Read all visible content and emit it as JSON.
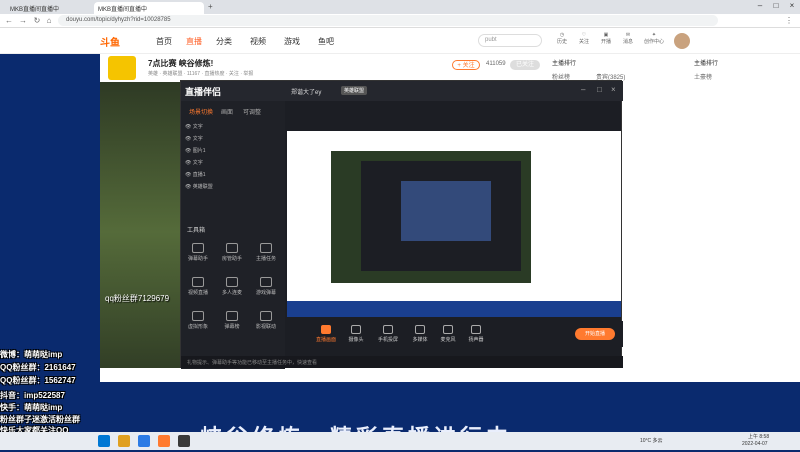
{
  "browser": {
    "tabs": [
      {
        "label": "MKB直播间直播中",
        "active": false
      },
      {
        "label": "MKB直播间直播中",
        "active": true
      }
    ],
    "url": "douyu.com/topic/dyhyzh?rid=10028785"
  },
  "site": {
    "logo": "斗鱼",
    "nav": [
      "首页",
      "直播",
      "分类",
      "视频",
      "游戏",
      "鱼吧"
    ],
    "active_nav": "直播",
    "search_placeholder": "pubt",
    "header_icons": [
      "历史",
      "关注",
      "开播",
      "消息",
      "创作中心"
    ]
  },
  "room": {
    "title": "7点比赛 峡谷修炼!",
    "meta": "英雄 · 英雄联盟 · 11167 · 直播热度 · 关注 · 举报",
    "follow_label": "+ 关注",
    "count_label": "411059",
    "subscribe_label": "已关注"
  },
  "app": {
    "name": "直播伴侣",
    "stream_title": "郑谐大了ey",
    "tag": "英雄联盟",
    "sidebar_tabs": [
      "场景切换",
      "画面",
      "可调整"
    ],
    "layers": [
      "文字",
      "文字",
      "图片1",
      "文字",
      "直播1",
      "英雄联盟"
    ],
    "tools_title": "工具箱",
    "tools": [
      "弹幕助手",
      "房管助手",
      "主播任务",
      "视频直播",
      "多人连麦",
      "游戏弹幕",
      "虚拟形象",
      "弹幕榜",
      "影视联动"
    ],
    "controls": [
      {
        "label": "直播画面",
        "on": true
      },
      {
        "label": "摄像头",
        "on": false
      },
      {
        "label": "手机投屏",
        "on": false
      },
      {
        "label": "多媒体",
        "on": false
      },
      {
        "label": "麦克风",
        "on": false
      },
      {
        "label": "扬声器",
        "on": false
      }
    ],
    "start_label": "开始直播",
    "status": "礼物提示、弹幕助手等功能已移动至主播任务中，快速查看"
  },
  "overlay": {
    "qq_group": "qq粉丝群7129679",
    "lines": [
      "微博：萌萌哒imp",
      "QQ粉丝群：2161647",
      "QQ粉丝群：1562747",
      "抖音：imp522587",
      "快手：萌萌哒imp",
      "粉丝群子迷激活粉丝群",
      "快乐大家都关注QQ"
    ],
    "big_text": "峡谷修炼，精彩直播进行中"
  },
  "taskbar": {
    "weather": "10°C 多云",
    "time": "上午 8:58",
    "date": "2022-04-07"
  },
  "right": {
    "tabs": [
      "主播排行",
      "主播排行"
    ],
    "items": [
      "粉丝榜",
      "贵宾(3825)",
      "土豪榜"
    ]
  }
}
